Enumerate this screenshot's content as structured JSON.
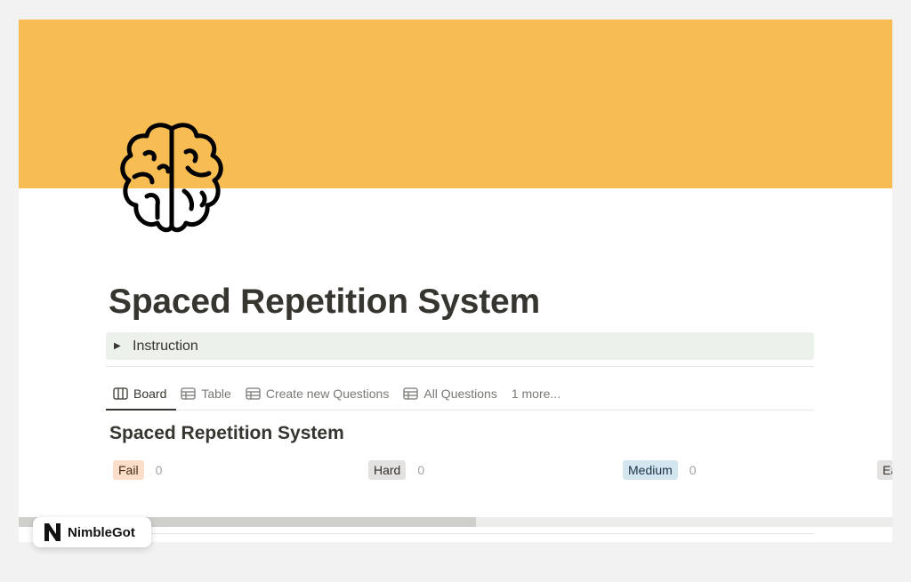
{
  "page": {
    "title": "Spaced Repetition System",
    "icon": "brain-icon",
    "cover_color": "#f8bd52"
  },
  "callout": {
    "label": "Instruction",
    "icon": "triangle-right-icon",
    "background": "#edf1ec"
  },
  "views": [
    {
      "label": "Board",
      "icon": "board-icon",
      "active": true
    },
    {
      "label": "Table",
      "icon": "table-icon",
      "active": false
    },
    {
      "label": "Create new Questions",
      "icon": "table-icon",
      "active": false
    },
    {
      "label": "All Questions",
      "icon": "table-icon",
      "active": false
    },
    {
      "label": "1 more...",
      "icon": "",
      "active": false
    }
  ],
  "database": {
    "title": "Spaced Repetition System"
  },
  "groups": [
    {
      "label": "Fail",
      "count": "0",
      "bg": "#fadec9",
      "color": "#49290e"
    },
    {
      "label": "Hard",
      "count": "0",
      "bg": "#e3e2e0",
      "color": "#32302c"
    },
    {
      "label": "Medium",
      "count": "0",
      "bg": "#d3e5ef",
      "color": "#183347"
    },
    {
      "label": "Ea",
      "count": "",
      "bg": "#dbeddb",
      "color": "#1c3829"
    }
  ],
  "badge": {
    "name": "NimbleGot"
  }
}
